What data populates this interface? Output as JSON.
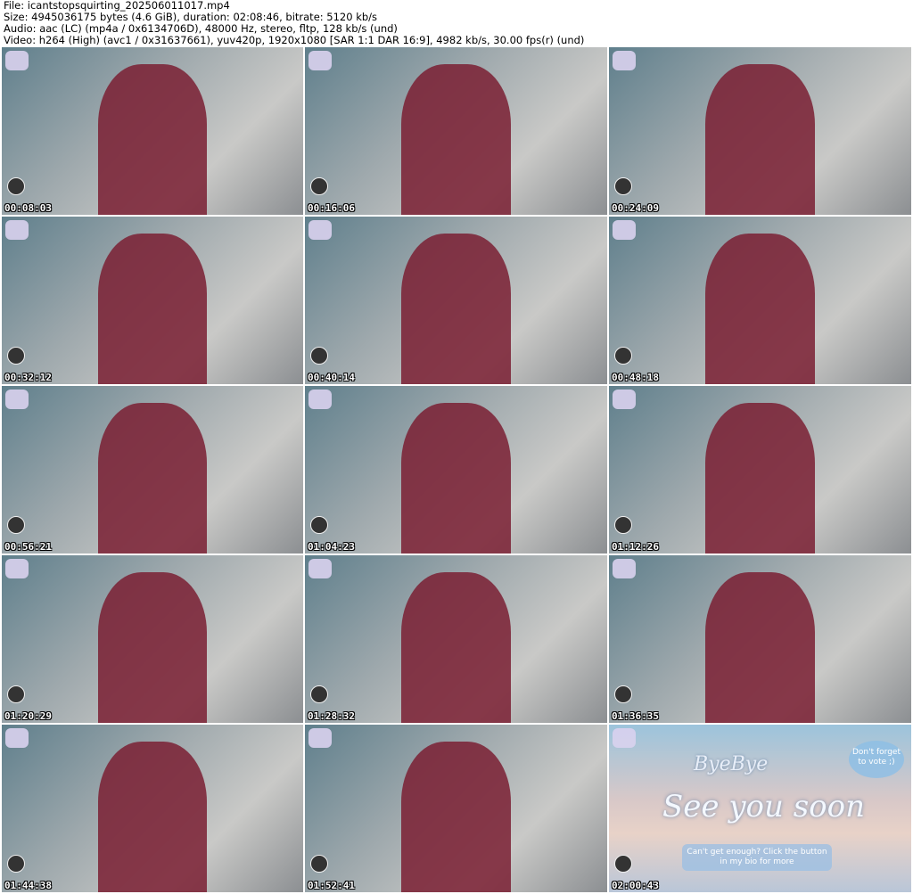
{
  "header": {
    "file": "File: icantstopsquirting_202506011017.mp4",
    "size": "Size: 4945036175 bytes (4.6 GiB), duration: 02:08:46, bitrate: 5120 kb/s",
    "audio": "Audio: aac (LC) (mp4a / 0x6134706D), 48000 Hz, stereo, fltp, 128 kb/s (und)",
    "video": "Video: h264 (High) (avc1 / 0x31637661), yuv420p, 1920x1080 [SAR 1:1 DAR 16:9], 4982 kb/s, 30.00 fps(r) (und)"
  },
  "thumbnails": [
    {
      "timestamp": "00:08:03"
    },
    {
      "timestamp": "00:16:06"
    },
    {
      "timestamp": "00:24:09"
    },
    {
      "timestamp": "00:32:12"
    },
    {
      "timestamp": "00:40:14"
    },
    {
      "timestamp": "00:48:18"
    },
    {
      "timestamp": "00:56:21"
    },
    {
      "timestamp": "01:04:23"
    },
    {
      "timestamp": "01:12:26"
    },
    {
      "timestamp": "01:20:29"
    },
    {
      "timestamp": "01:28:32"
    },
    {
      "timestamp": "01:36:35"
    },
    {
      "timestamp": "01:44:38"
    },
    {
      "timestamp": "01:52:41"
    },
    {
      "timestamp": "02:00:43"
    }
  ],
  "end_screen": {
    "title": "ByeBye",
    "subtitle": "See you soon",
    "bubble": "Don't forget to vote ;)",
    "button": "Can't get enough? Click the button in my bio for more"
  }
}
